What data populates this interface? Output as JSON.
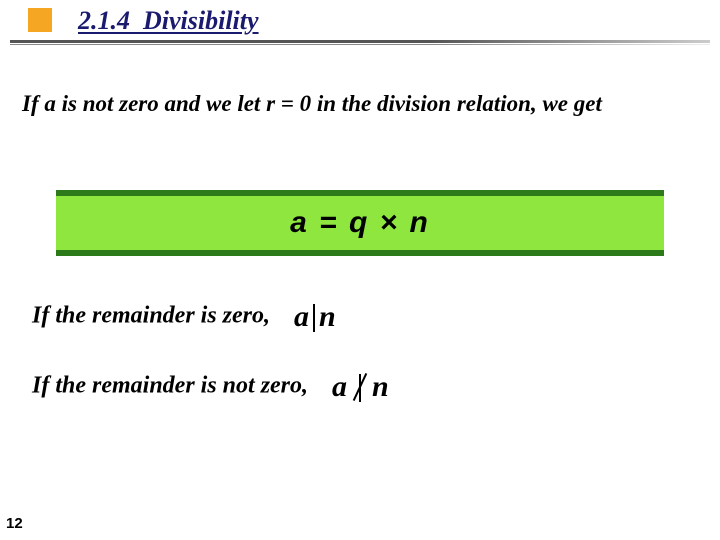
{
  "header": {
    "section_number": "2.1.4",
    "section_title": "Divisibility"
  },
  "intro_text": "If a is not zero and we let  r = 0 in the division relation, we get",
  "equation": "a = q × n",
  "remainder_zero_text": "If the remainder is zero,",
  "remainder_nonzero_text": "If the remainder is not zero,",
  "notation": {
    "a": "a",
    "n": "n"
  },
  "page_number": "12"
}
